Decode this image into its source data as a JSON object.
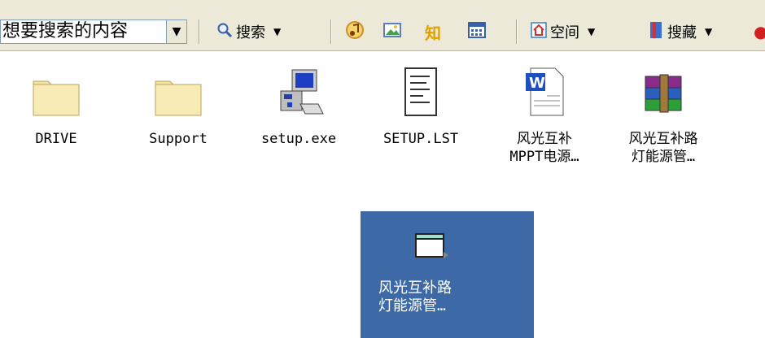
{
  "toolbar": {
    "search_input_value": "想要搜索的内容",
    "search_button_label": "搜索",
    "space_label": "空间",
    "favorites_label": "搜藏",
    "icons": [
      "magnifier-icon",
      "music-note-icon",
      "image-icon",
      "zhi-knowledge-icon",
      "calendar-icon",
      "home-icon",
      "bookmark-icon"
    ]
  },
  "files": [
    {
      "label": "DRIVE",
      "icon": "folder-icon"
    },
    {
      "label": "Support",
      "icon": "folder-icon"
    },
    {
      "label": "setup.exe",
      "icon": "setup-installer-icon"
    },
    {
      "label": "SETUP.LST",
      "icon": "text-document-icon"
    },
    {
      "label": "风光互补\nMPPT电源…",
      "icon": "word-document-icon"
    },
    {
      "label": "风光互补路\n灯能源管…",
      "icon": "winrar-archive-icon"
    }
  ],
  "selected_item": {
    "label": "风光互补路\n灯能源管…",
    "icon": "window-file-icon",
    "highlight_color": "#3d6aa6"
  }
}
